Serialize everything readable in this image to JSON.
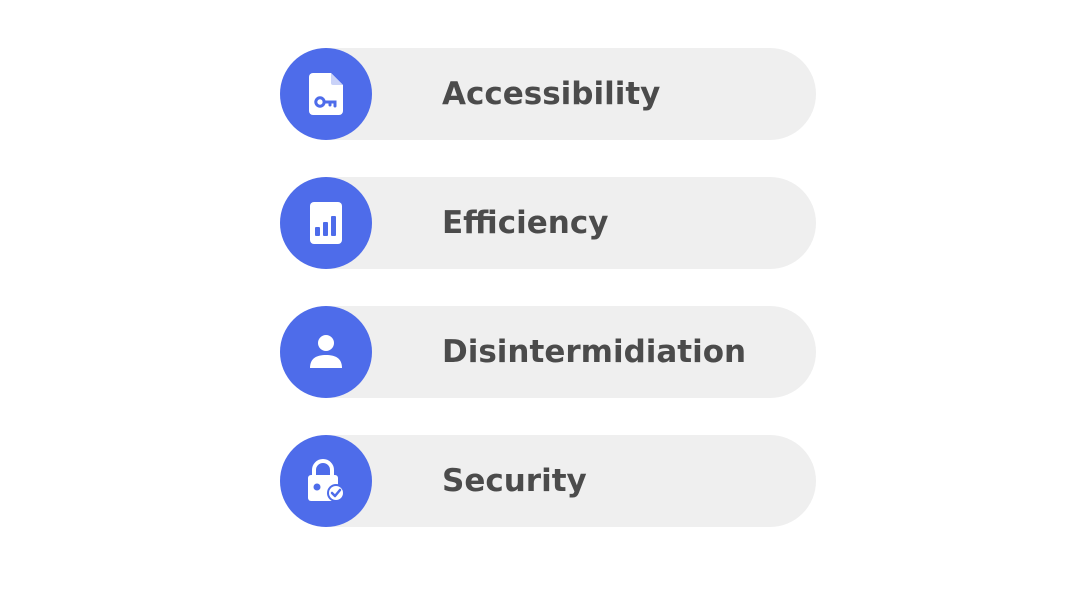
{
  "accent_color": "#4e6cea",
  "items": [
    {
      "label": "Accessibility",
      "icon": "file-key-icon"
    },
    {
      "label": "Efficiency",
      "icon": "bar-chart-document-icon"
    },
    {
      "label": "Disintermidiation",
      "icon": "person-icon"
    },
    {
      "label": "Security",
      "icon": "lock-check-icon"
    }
  ]
}
